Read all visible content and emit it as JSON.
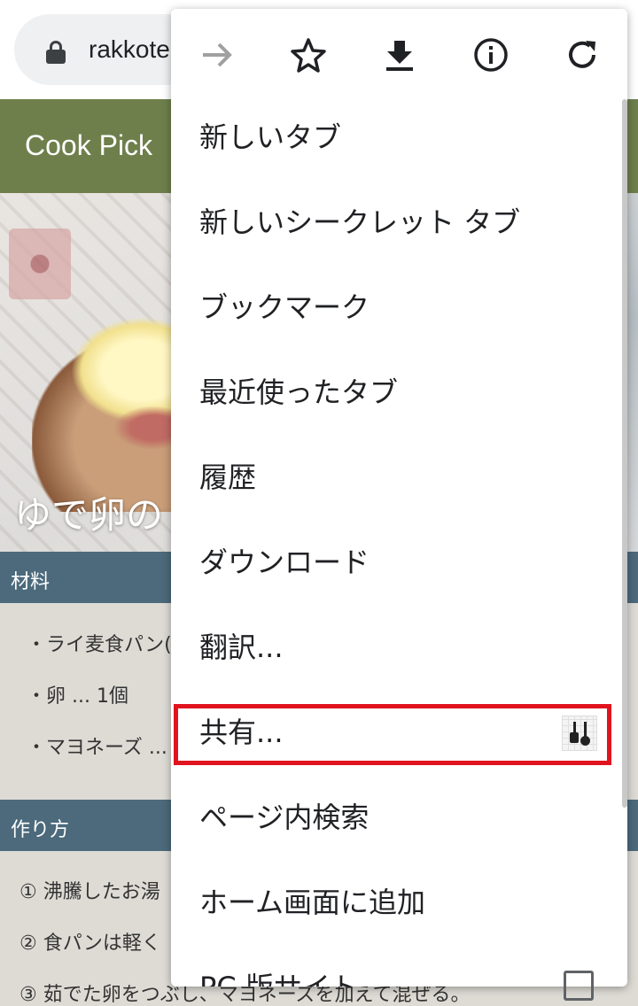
{
  "browser": {
    "url_text": "rakkote"
  },
  "page": {
    "site_title": "Cook Pick",
    "hero_title": "ゆで卵の",
    "ingredients_heading": "材料",
    "ingredients": [
      "・ライ麦食パン(",
      "・卵 ... 1個",
      "・マヨネーズ ..."
    ],
    "steps_heading": "作り方",
    "steps": [
      "① 沸騰したお湯",
      "② 食パンは軽く",
      "③ 茹でた卵をつぶし、マヨネーズを加えて混ぜる。"
    ]
  },
  "menu": {
    "icons": [
      "forward-icon",
      "star-icon",
      "download-icon",
      "info-icon",
      "refresh-icon"
    ],
    "items": [
      "新しいタブ",
      "新しいシークレット タブ",
      "ブックマーク",
      "最近使ったタブ",
      "履歴",
      "ダウンロード",
      "翻訳...",
      "共有...",
      "ページ内検索",
      "ホーム画面に追加",
      "PC 版サイト"
    ]
  },
  "colors": {
    "header_green": "#6e7f4c",
    "section_blue": "#4c6a7c",
    "highlight_red": "#e0141f"
  }
}
